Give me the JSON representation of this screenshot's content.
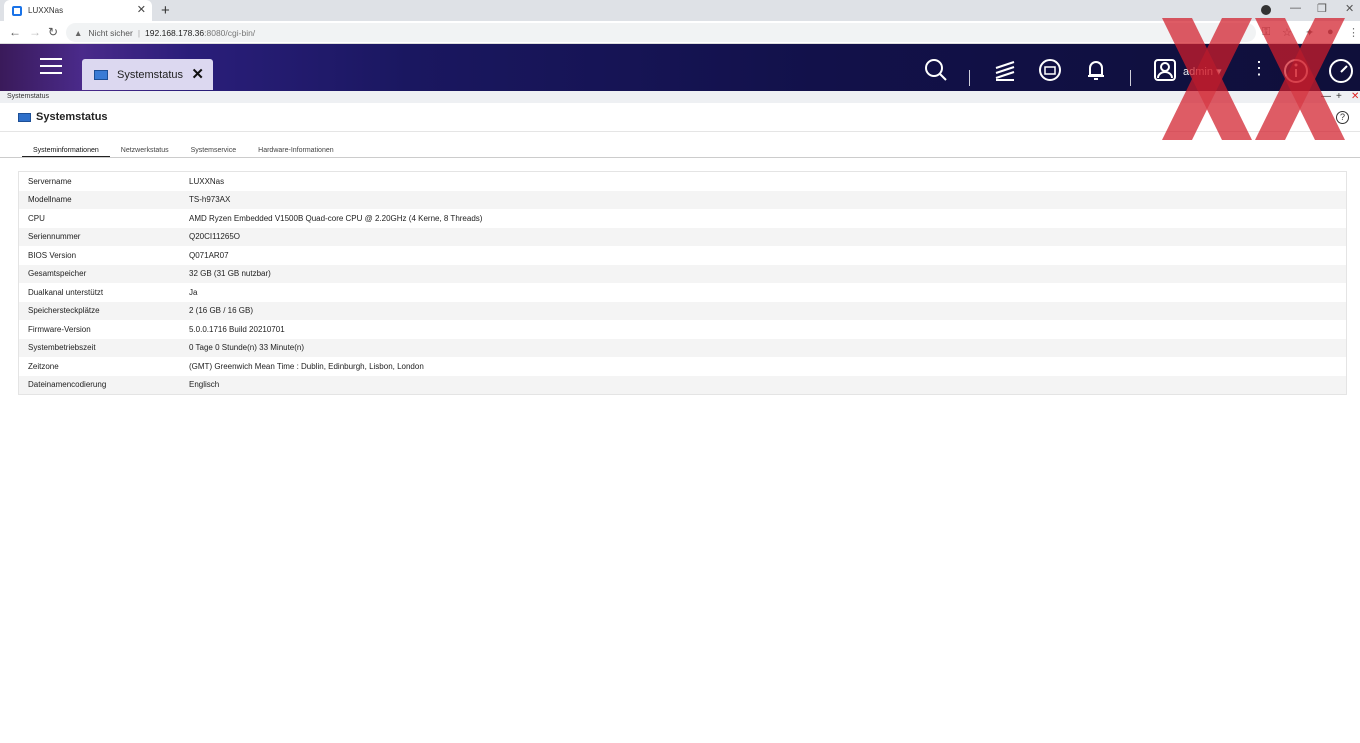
{
  "browser": {
    "tab_title": "LUXXNas",
    "security_label": "Nicht sicher",
    "url_host": "192.168.178.36",
    "url_path": ":8080/cgi-bin/"
  },
  "header": {
    "app_tab_label": "Systemstatus",
    "user": "admin"
  },
  "window": {
    "titlebar_label": "Systemstatus",
    "title": "Systemstatus"
  },
  "tabs": [
    {
      "label": "Systeminformationen",
      "active": true
    },
    {
      "label": "Netzwerkstatus",
      "active": false
    },
    {
      "label": "Systemservice",
      "active": false
    },
    {
      "label": "Hardware-Informationen",
      "active": false
    }
  ],
  "system_info": [
    {
      "key": "Servername",
      "value": "LUXXNas"
    },
    {
      "key": "Modellname",
      "value": "TS-h973AX"
    },
    {
      "key": "CPU",
      "value": "AMD Ryzen Embedded V1500B Quad-core CPU @ 2.20GHz (4 Kerne, 8 Threads)"
    },
    {
      "key": "Seriennummer",
      "value": "Q20CI11265O"
    },
    {
      "key": "BIOS Version",
      "value": "Q071AR07"
    },
    {
      "key": "Gesamtspeicher",
      "value": "32 GB (31 GB nutzbar)"
    },
    {
      "key": "Dualkanal unterstützt",
      "value": "Ja"
    },
    {
      "key": "Speichersteckplätze",
      "value": "2 (16 GB / 16 GB)"
    },
    {
      "key": "Firmware-Version",
      "value": "5.0.0.1716 Build 20210701"
    },
    {
      "key": "Systembetriebszeit",
      "value": "0 Tage 0 Stunde(n) 33 Minute(n)"
    },
    {
      "key": "Zeitzone",
      "value": "(GMT) Greenwich Mean Time : Dublin, Edinburgh, Lisbon, London"
    },
    {
      "key": "Dateinamencodierung",
      "value": "Englisch"
    }
  ]
}
